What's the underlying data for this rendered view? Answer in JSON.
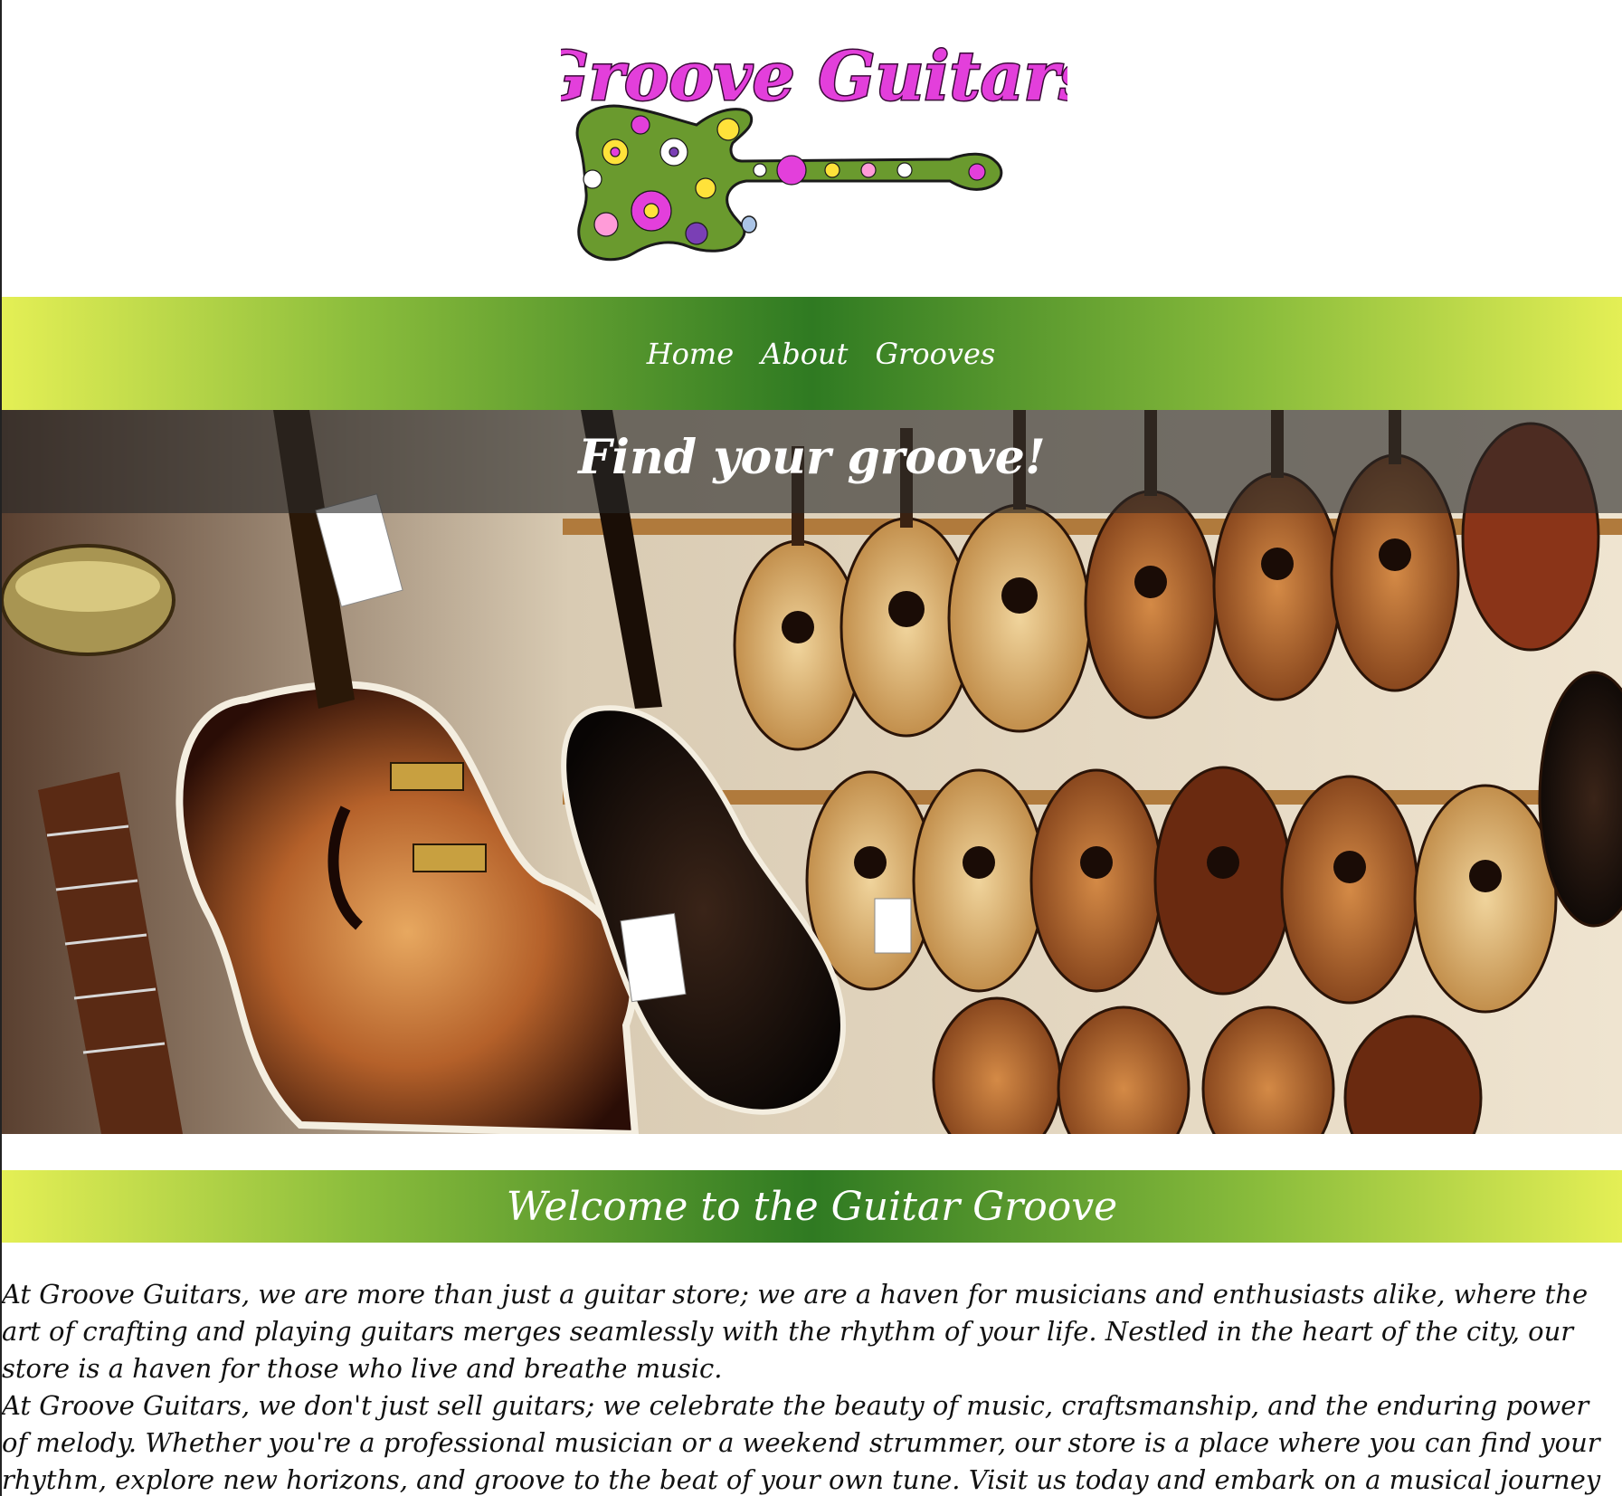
{
  "logo": {
    "text": "Groove Guitars",
    "text_color": "#e33fdb",
    "guitar_body_color": "#6a9a2e",
    "flower_colors": [
      "#e33fdb",
      "#ffe23a",
      "#ff9bd8",
      "#ffffff",
      "#7a3fb5"
    ]
  },
  "nav": {
    "items": [
      {
        "label": "Home"
      },
      {
        "label": "About"
      },
      {
        "label": "Grooves"
      }
    ],
    "gradient": [
      "#e4ef55",
      "#2f7a22",
      "#e4ef55"
    ]
  },
  "hero": {
    "title": "Find your groove!",
    "image_alt": "guitar-store-photo"
  },
  "welcome": {
    "title": "Welcome to the Guitar Groove"
  },
  "content": {
    "paragraph_1": "At Groove Guitars, we are more than just a guitar store; we are a haven for musicians and enthusiasts alike, where the art of crafting and playing guitars merges seamlessly with the rhythm of your life. Nestled in the heart of the city, our store is a haven for those who live and breathe music.",
    "paragraph_2": "At Groove Guitars, we don't just sell guitars; we celebrate the beauty of music, craftsmanship, and the enduring power of melody. Whether you're a professional musician or a weekend strummer, our store is a place where you can find your rhythm, explore new horizons, and groove to the beat of your own tune. Visit us today and embark on a musical journey that"
  }
}
